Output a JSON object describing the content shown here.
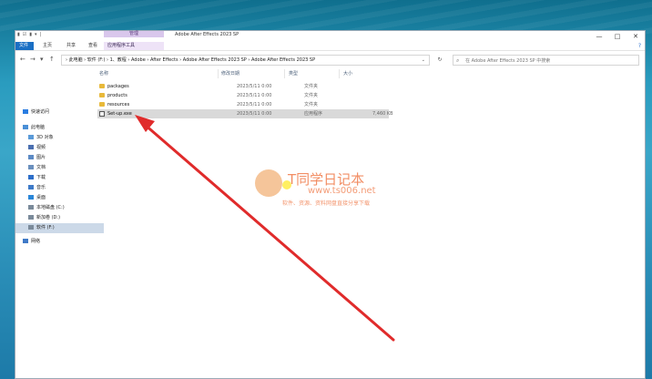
{
  "window": {
    "title": "Adobe After Effects 2023 SP",
    "context_tab": "管理",
    "controls": {
      "minimize": "—",
      "maximize": "□",
      "close": "✕"
    }
  },
  "ribbon": {
    "tabs": [
      "文件",
      "主页",
      "共享",
      "查看",
      "应用程序工具"
    ],
    "help": "?"
  },
  "address": {
    "crumbs": "› 此电脑 › 软件 (F:) › 1、教程 › Adobe › After Effects › Adobe After Effects 2023 SP › Adobe After Effects 2023 SP",
    "search_placeholder": "在 Adobe After Effects 2023 SP 中搜索"
  },
  "sidebar": {
    "items": [
      {
        "label": "快速访问",
        "icon": "star-icon",
        "color": "#2a7de1"
      },
      {
        "label": "此电脑",
        "icon": "computer-icon",
        "color": "#4a8fd6"
      },
      {
        "label": "3D 对象",
        "icon": "cube-icon",
        "color": "#5a9ad8"
      },
      {
        "label": "视频",
        "icon": "video-icon",
        "color": "#4a6fb0"
      },
      {
        "label": "图片",
        "icon": "picture-icon",
        "color": "#5c8ac4"
      },
      {
        "label": "文档",
        "icon": "document-icon",
        "color": "#6a8fbd"
      },
      {
        "label": "下载",
        "icon": "download-icon",
        "color": "#2d6ec9"
      },
      {
        "label": "音乐",
        "icon": "music-icon",
        "color": "#3d7ac8"
      },
      {
        "label": "桌面",
        "icon": "desktop-icon",
        "color": "#2a86d8"
      },
      {
        "label": "本地磁盘 (C:)",
        "icon": "drive-icon",
        "color": "#7a8a9a"
      },
      {
        "label": "新加卷 (D:)",
        "icon": "drive-icon",
        "color": "#7a8a9a"
      },
      {
        "label": "软件 (F:)",
        "icon": "drive-icon",
        "color": "#7a8a9a"
      },
      {
        "label": "网络",
        "icon": "network-icon",
        "color": "#3f79c7"
      }
    ]
  },
  "columns": {
    "name": "名称",
    "modified": "修改日期",
    "type": "类型",
    "size": "大小"
  },
  "files": [
    {
      "name": "packages",
      "modified": "2023/5/11 0:00",
      "type": "文件夹",
      "size": "",
      "kind": "folder"
    },
    {
      "name": "products",
      "modified": "2023/5/11 0:00",
      "type": "文件夹",
      "size": "",
      "kind": "folder"
    },
    {
      "name": "resources",
      "modified": "2023/5/11 0:00",
      "type": "文件夹",
      "size": "",
      "kind": "folder"
    },
    {
      "name": "Set-up.exe",
      "modified": "2023/5/11 0:00",
      "type": "应用程序",
      "size": "7,460 KB",
      "kind": "exe"
    }
  ],
  "watermark": {
    "title": "T同学日记本",
    "url": "www.ts006.net",
    "subtitle": "软件、资源、资料网盘直接分享下载"
  },
  "colors": {
    "accent": "#1a6fc4",
    "arrow": "#e02b2b",
    "selected_row": "#d9d9d9"
  }
}
